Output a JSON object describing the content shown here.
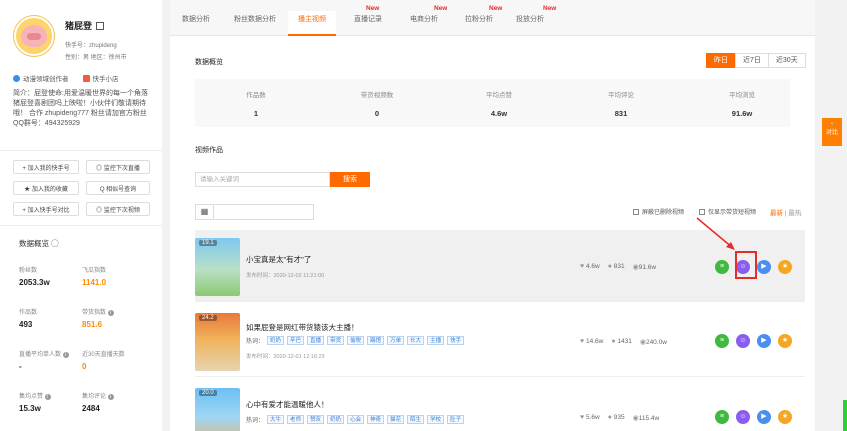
{
  "profile": {
    "name": "猪屁登",
    "kuaishou_id": "快手号：zhupideng",
    "gender_location": "性别：男  地区：徐州市",
    "badge1": "动漫领域创作者",
    "badge2": "快手小店",
    "bio": "简介：屁登使命:用爱温暖世界的每一个角落 猪屁登喜剧团吗上映啦！小伙伴们敬请期待哦！ 合作 zhupideng777 粉丝请加官方粉丝QQ群号：494325929"
  },
  "actions": {
    "add_my": "+ 加入我的快手号",
    "live_remind": "◎ 监控下次直播",
    "add_fav": "★ 加入我的收藏",
    "similar": "Q 相似号查询",
    "add_compare": "+ 加入快手号对比",
    "video_remind": "◎ 监控下次视频"
  },
  "overview": {
    "title": "数据概览 ◯",
    "stats": [
      {
        "label": "粉丝数",
        "value": "2053.3w"
      },
      {
        "label": "飞瓜指数",
        "value": "1141.0"
      },
      {
        "label": "作品数",
        "value": "493"
      },
      {
        "label": "带货指数",
        "value": "851.6"
      },
      {
        "label": "直播平均单人数",
        "value": "-"
      },
      {
        "label": "近30天直播天数",
        "value": "0"
      },
      {
        "label": "集均点赞",
        "value": "15.3w"
      },
      {
        "label": "集均评论",
        "value": "2484"
      }
    ]
  },
  "tabs": [
    {
      "label": "数据分析"
    },
    {
      "label": "粉丝数据分析"
    },
    {
      "label": "播主视频"
    },
    {
      "label": "直播记录",
      "badge": "New"
    },
    {
      "label": "电商分析",
      "badge": "New"
    },
    {
      "label": "拉粉分析",
      "badge": "New"
    },
    {
      "label": "投放分析",
      "badge": "New"
    }
  ],
  "summary": {
    "title": "数据概览",
    "range": [
      "昨日",
      "近7日",
      "近30天"
    ],
    "columns": [
      {
        "label": "作品数",
        "value": "1"
      },
      {
        "label": "带货视频数",
        "value": "0"
      },
      {
        "label": "平均点赞",
        "value": "4.6w"
      },
      {
        "label": "平均评论",
        "value": "831"
      },
      {
        "label": "平均浏览",
        "value": "91.6w"
      }
    ]
  },
  "works": {
    "title": "视频作品",
    "search_placeholder": "请输入关键词",
    "search_btn": "搜索",
    "filter1": "屏蔽已删除视频",
    "filter2": "仅显示带货短视频",
    "sort_latest": "最新",
    "sort_sep": " | ",
    "sort_hot": "最热"
  },
  "videos": [
    {
      "rank": "19.1",
      "title": "小宝真是太\"有才\"了",
      "tags_label": "",
      "tags": [],
      "time": "发布时间：2020-12-02 11:21:00",
      "likes": "4.6w",
      "comments": "831",
      "views": "91.6w"
    },
    {
      "rank": "24.2",
      "title": "如果屁登是网红带货猿该大主播！",
      "tags_label": "热词：",
      "tags": [
        "奶奶",
        "辛巴",
        "直播",
        "带货",
        "偷税",
        "踢馆",
        "万单",
        "长大",
        "主播",
        "快手"
      ],
      "time": "发布时间：2020-12-01 12:16:23",
      "likes": "14.6w",
      "comments": "1431",
      "views": "240.0w"
    },
    {
      "rank": "20.0",
      "title": "心中有爱才能温暖他人！",
      "tags_label": "热词：",
      "tags": [
        "大牛",
        "老师",
        "赞叹",
        "奶奶",
        "心会",
        "神奇",
        "猫花",
        "陌生",
        "学校",
        "肚子"
      ],
      "time": "",
      "likes": "5.6w",
      "comments": "935",
      "views": "115.4w"
    }
  ],
  "side_compare": "对比"
}
